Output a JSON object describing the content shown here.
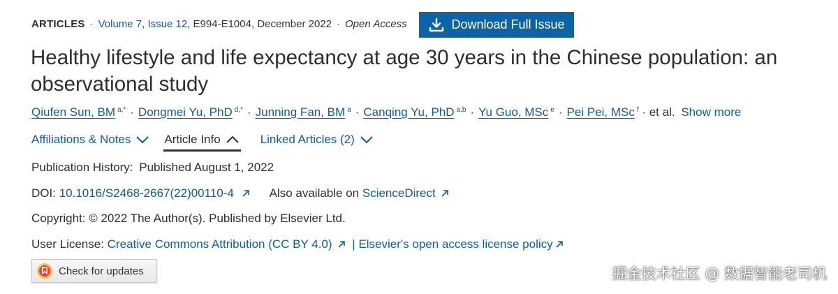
{
  "meta": {
    "section": "ARTICLES",
    "volume_issue": "Volume 7, Issue 12",
    "pages_date": ", E994-E1004, December 2022",
    "access": "Open Access"
  },
  "download_button": {
    "label": "Download Full Issue",
    "icon": "download-icon"
  },
  "title": "Healthy lifestyle and life expectancy at age 30 years in the Chinese population: an observational study",
  "authors": [
    {
      "name": "Qiufen Sun, BM",
      "sup": "a,*"
    },
    {
      "name": "Dongmei Yu, PhD",
      "sup": "d,*"
    },
    {
      "name": "Junning Fan, BM",
      "sup": "a"
    },
    {
      "name": "Canqing Yu, PhD",
      "sup": "a,b"
    },
    {
      "name": "Yu Guo, MSc",
      "sup": "e"
    },
    {
      "name": "Pei Pei, MSc",
      "sup": "f"
    }
  ],
  "authors_etal": "· et al.",
  "show_more": "Show more",
  "tabs": [
    {
      "label": "Affiliations & Notes",
      "icon": "chevron-down-icon",
      "state": "link"
    },
    {
      "label": "Article Info",
      "icon": "chevron-up-icon",
      "state": "active"
    },
    {
      "label": "Linked Articles (2)",
      "icon": "chevron-down-icon",
      "state": "link"
    }
  ],
  "article_info": {
    "publication_history_label": "Publication History:",
    "publication_history_value": "Published August 1, 2022",
    "doi_label": "DOI:",
    "doi_value": "10.1016/S2468-2667(22)00110-4",
    "also_available_label": "Also available on",
    "also_available_link": "ScienceDirect",
    "copyright": "Copyright: © 2022 The Author(s). Published by Elsevier Ltd.",
    "license_label": "User License:",
    "license_link": "Creative Commons Attribution (CC BY 4.0)",
    "license_separator": "|",
    "policy_link": "Elsevier's open access license policy"
  },
  "check_updates": {
    "label": "Check for updates"
  },
  "watermark": "掘金技术社区 @ 数据智能老司机",
  "colors": {
    "link": "#0c5da8",
    "button": "#0c64a8",
    "text": "#2e2e2e"
  }
}
